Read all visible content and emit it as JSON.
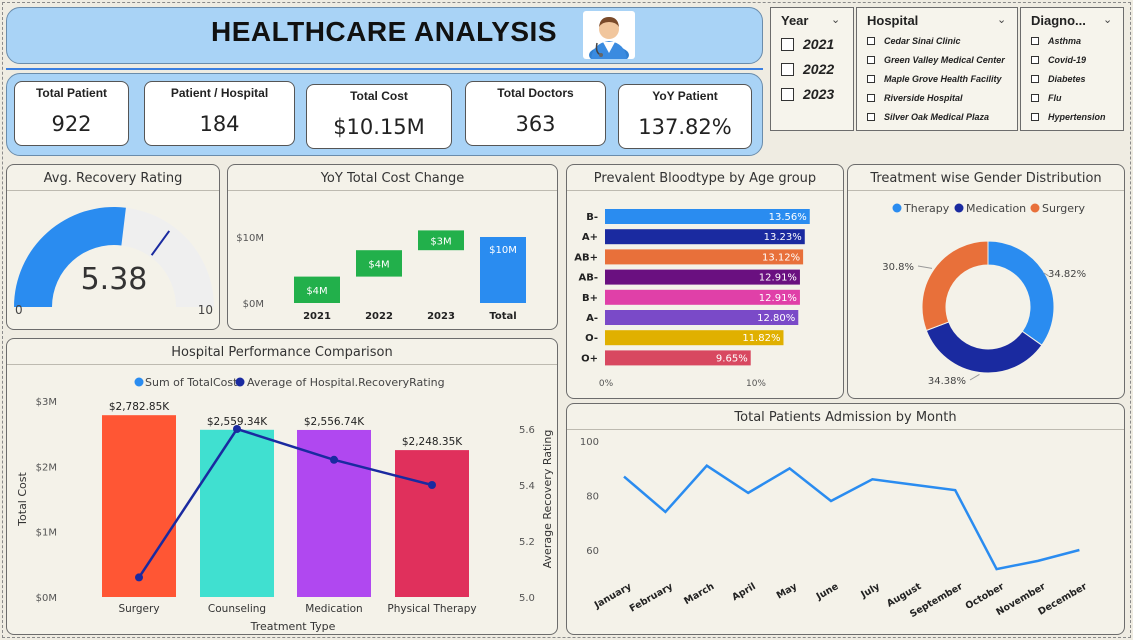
{
  "header": {
    "title": "HEALTHCARE ANALYSIS"
  },
  "kpis": [
    {
      "label": "Total Patient",
      "value": "922"
    },
    {
      "label": "Patient / Hospital",
      "value": "184"
    },
    {
      "label": "Total Cost",
      "value": "$10.15M"
    },
    {
      "label": "Total Doctors",
      "value": "363"
    },
    {
      "label": "YoY Patient",
      "value": "137.82%"
    }
  ],
  "slicers": {
    "year": {
      "title": "Year",
      "items": [
        "2021",
        "2022",
        "2023"
      ]
    },
    "hospital": {
      "title": "Hospital",
      "items": [
        "Cedar Sinai Clinic",
        "Green Valley Medical Center",
        "Maple Grove Health Facility",
        "Riverside Hospital",
        "Silver Oak Medical Plaza"
      ]
    },
    "diagnosis": {
      "title": "Diagno...",
      "items": [
        "Asthma",
        "Covid-19",
        "Diabetes",
        "Flu",
        "Hypertension"
      ]
    }
  },
  "gauge": {
    "title": "Avg. Recovery Rating",
    "value_label": "5.38",
    "min_label": "0",
    "max_label": "10",
    "value": 5.38,
    "min": 0,
    "max": 10,
    "target": 7.0
  },
  "colors": {
    "therapy": "#2a8cf0",
    "medication": "#1a2aa0",
    "surgery": "#e8703a",
    "gauge_fill": "#2a8cf0",
    "waterfall_up": "#22b04b",
    "waterfall_total": "#2a8cf0",
    "line_blue": "#2a8cf0"
  },
  "chart_data": [
    {
      "type": "bar",
      "title": "YoY Total Cost Change",
      "subtype": "waterfall",
      "categories": [
        "2021",
        "2022",
        "2023",
        "Total"
      ],
      "values": [
        4,
        4,
        3,
        10
      ],
      "labels": [
        "$4M",
        "$4M",
        "$3M",
        "$10M"
      ],
      "y_ticks": [
        "$0M",
        "$10M"
      ]
    },
    {
      "type": "bar",
      "title": "Prevalent Bloodtype by Age group",
      "orientation": "horizontal",
      "categories": [
        "B-",
        "A+",
        "AB+",
        "AB-",
        "B+",
        "A-",
        "O-",
        "O+"
      ],
      "values": [
        13.56,
        13.23,
        13.12,
        12.91,
        12.91,
        12.8,
        11.82,
        9.65
      ],
      "labels": [
        "13.56%",
        "13.23%",
        "13.12%",
        "12.91%",
        "12.91%",
        "12.80%",
        "11.82%",
        "9.65%"
      ],
      "colors": [
        "#2a8cf0",
        "#1a2aa0",
        "#e8703a",
        "#6a1080",
        "#e040a8",
        "#7a4ac8",
        "#e0b000",
        "#d84860"
      ],
      "x_ticks": [
        "0%",
        "10%"
      ]
    },
    {
      "type": "pie",
      "title": "Treatment wise Gender Distribution",
      "categories": [
        "Therapy",
        "Medication",
        "Surgery"
      ],
      "values": [
        34.82,
        34.38,
        30.8
      ],
      "labels": [
        "34.82%",
        "34.38%",
        "30.8%"
      ]
    },
    {
      "type": "bar",
      "title": "Hospital Performance Comparison",
      "combo": true,
      "xlabel": "Treatment Type",
      "ylabel": "Total Cost",
      "y2label": "Average Recovery Rating",
      "categories": [
        "Surgery",
        "Counseling",
        "Medication",
        "Physical Therapy"
      ],
      "series": [
        {
          "name": "Sum of TotalCost",
          "values": [
            2782.85,
            2559.34,
            2556.74,
            2248.35
          ],
          "labels": [
            "$2,782.85K",
            "$2,559.34K",
            "$2,556.74K",
            "$2,248.35K"
          ]
        },
        {
          "name": "Average of Hospital.RecoveryRating",
          "values": [
            5.07,
            5.6,
            5.49,
            5.4
          ]
        }
      ],
      "bar_colors": [
        "#ff5634",
        "#40e0d0",
        "#b048f0",
        "#e0305c"
      ],
      "ylim": [
        0,
        3000
      ],
      "y_ticks": [
        "$0M",
        "$1M",
        "$2M",
        "$3M"
      ],
      "y2lim": [
        5.0,
        5.6
      ],
      "y2_ticks": [
        "5.0",
        "5.2",
        "5.4",
        "5.6"
      ]
    },
    {
      "type": "line",
      "title": "Total Patients Admission by Month",
      "x": [
        "January",
        "February",
        "March",
        "April",
        "May",
        "June",
        "July",
        "August",
        "September",
        "October",
        "November",
        "December"
      ],
      "values": [
        87,
        74,
        91,
        81,
        90,
        78,
        86,
        84,
        82,
        53,
        56,
        60
      ],
      "ylim": [
        50,
        100
      ],
      "y_ticks": [
        "100",
        "80",
        "60"
      ]
    }
  ]
}
